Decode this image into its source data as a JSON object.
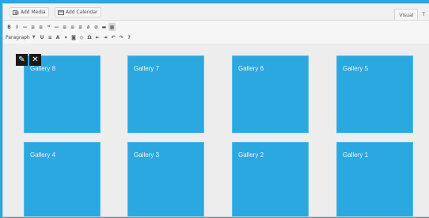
{
  "media_bar": {
    "add_media": "Add Media",
    "add_calendar": "Add Calendar"
  },
  "mode_tabs": {
    "visual": "Visual",
    "text": "T"
  },
  "toolbar": {
    "row1": [
      {
        "glyph": "B",
        "name": "bold-button"
      },
      {
        "glyph": "I",
        "name": "italic-button"
      },
      {
        "glyph": "—",
        "name": "strikethrough-button"
      },
      {
        "glyph": "≡",
        "name": "bulleted-list-button"
      },
      {
        "glyph": "≡",
        "name": "numbered-list-button"
      },
      {
        "glyph": "❝",
        "name": "blockquote-button"
      },
      {
        "glyph": "—",
        "name": "horizontal-line-button"
      },
      {
        "glyph": "≡",
        "name": "align-left-button"
      },
      {
        "glyph": "≡",
        "name": "align-center-button"
      },
      {
        "glyph": "≡",
        "name": "align-right-button"
      },
      {
        "glyph": "∂",
        "name": "insert-link-button"
      },
      {
        "glyph": "⊘",
        "name": "remove-link-button"
      },
      {
        "glyph": "▬",
        "name": "read-more-button"
      },
      {
        "glyph": "▦",
        "name": "toolbar-toggle-button",
        "active": true
      }
    ],
    "format_select": "Paragraph",
    "row2": [
      {
        "glyph": "U",
        "name": "underline-button"
      },
      {
        "glyph": "≡",
        "name": "justify-button"
      },
      {
        "glyph": "A",
        "name": "text-color-button"
      },
      {
        "glyph": "▾",
        "name": "text-color-dropdown"
      },
      {
        "glyph": "◙",
        "name": "paste-as-text-button"
      },
      {
        "glyph": "◇",
        "name": "clear-formatting-button"
      },
      {
        "glyph": "Ω",
        "name": "special-character-button"
      },
      {
        "glyph": "⇤",
        "name": "outdent-button"
      },
      {
        "glyph": "⇥",
        "name": "indent-button"
      },
      {
        "glyph": "↶",
        "name": "undo-button"
      },
      {
        "glyph": "↷",
        "name": "redo-button"
      },
      {
        "glyph": "?",
        "name": "help-button"
      }
    ]
  },
  "galleries": [
    {
      "label": "Gallery 8"
    },
    {
      "label": "Gallery 7"
    },
    {
      "label": "Gallery 6"
    },
    {
      "label": "Gallery 5"
    },
    {
      "label": "Gallery 4"
    },
    {
      "label": "Gallery 3"
    },
    {
      "label": "Gallery 2"
    },
    {
      "label": "Gallery 1"
    }
  ],
  "edit_controls": {
    "edit_glyph": "✎",
    "remove_glyph": "✕"
  },
  "colors": {
    "accent": "#2aa8df",
    "tile": "#2aa8df",
    "controls": "#1a1a1a"
  }
}
